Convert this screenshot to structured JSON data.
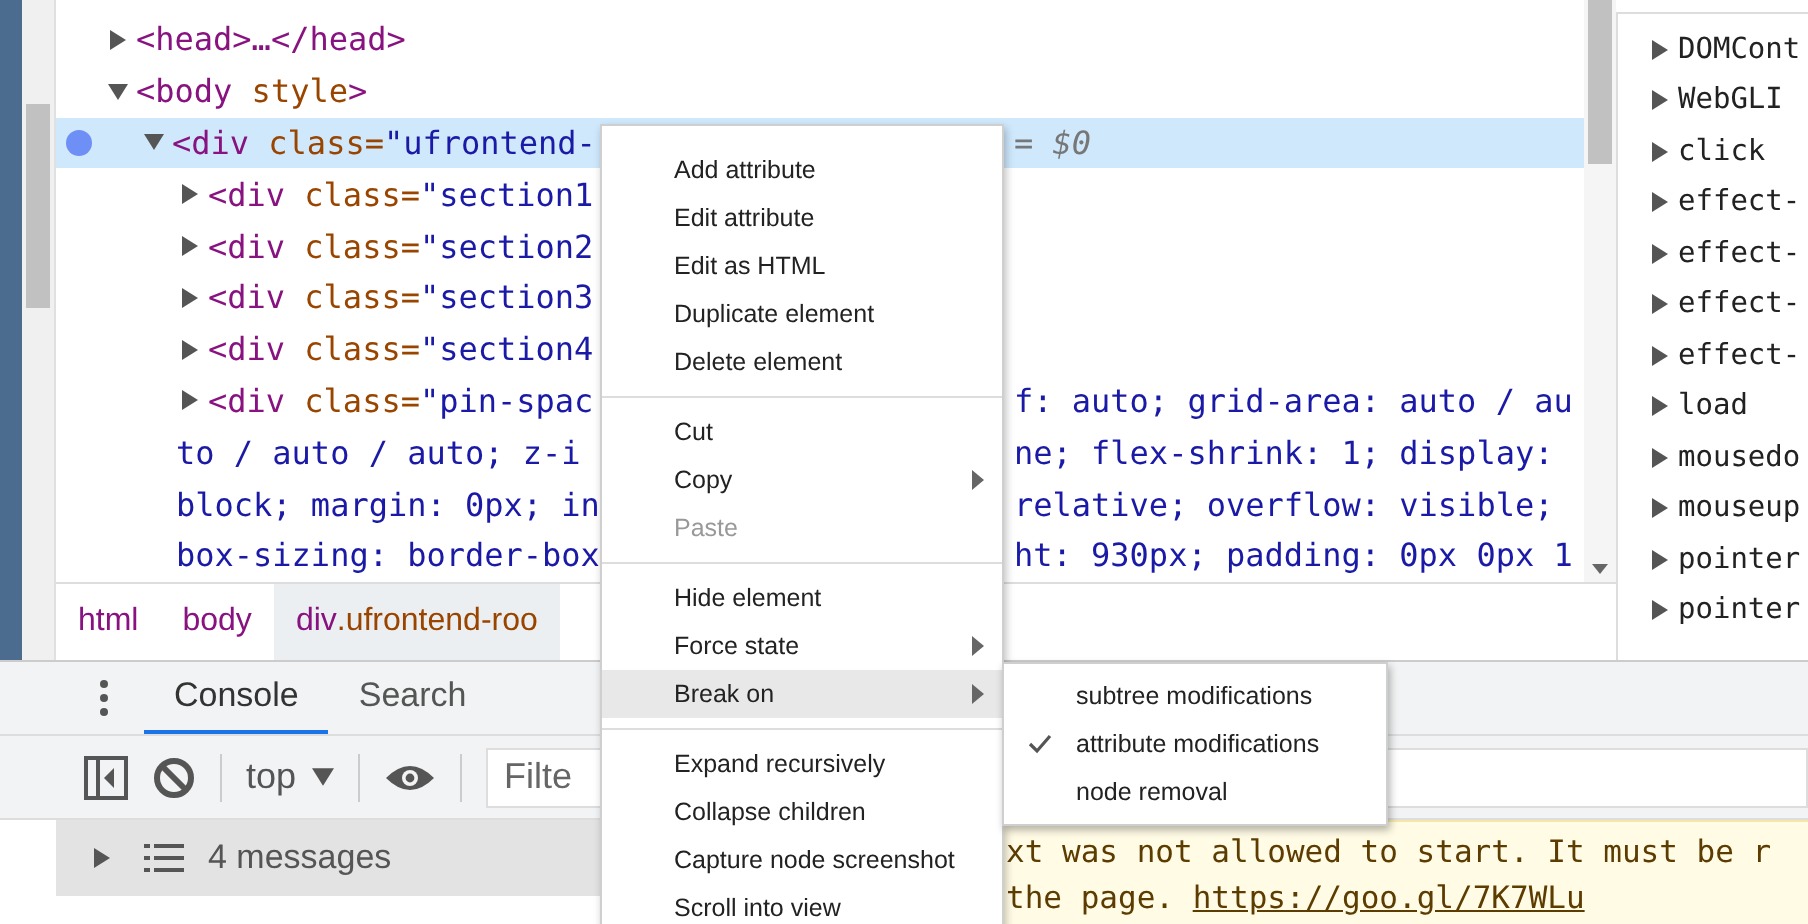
{
  "elements_tree": [
    {
      "text": "<head>…</head>",
      "expanded": false,
      "selected": false,
      "breakpoint": false
    },
    {
      "text": "<body style>",
      "expanded": true,
      "selected": false,
      "breakpoint": false,
      "children": [
        {
          "text": "<div class=\"ufrontend-",
          "marker": "= $0",
          "expanded": true,
          "selected": true,
          "breakpoint": true,
          "children": [
            {
              "text": "<div class=\"section1",
              "expanded": false,
              "selected": false,
              "breakpoint": false
            },
            {
              "text": "<div class=\"section2",
              "expanded": false,
              "selected": false,
              "breakpoint": false
            },
            {
              "text": "<div class=\"section3",
              "expanded": false,
              "selected": false,
              "breakpoint": false
            },
            {
              "text": "<div class=\"section4",
              "expanded": false,
              "selected": false,
              "breakpoint": false
            },
            {
              "text": "<div class=\"pin-spac",
              "after_menu": "f: auto; grid-area: auto / au",
              "expanded": false,
              "selected": false,
              "breakpoint": false,
              "wrapped_lines": [
                {
                  "text": "to / auto / auto; z-i",
                  "after_menu": "ne; flex-shrink: 1; display:"
                },
                {
                  "text": "block; margin: 0px; in",
                  "after_menu": "relative; overflow: visible;"
                },
                {
                  "text": "box-sizing: border-box",
                  "after_menu": "ht: 930px; padding: 0px 0px 1"
                }
              ]
            }
          ]
        }
      ]
    }
  ],
  "breadcrumbs": [
    {
      "text": "html",
      "selected": false
    },
    {
      "text": "body",
      "selected": false
    },
    {
      "text": "div.ufrontend-roo",
      "selected": true
    }
  ],
  "event_listeners": [
    {
      "text": "DOMCont",
      "expanded": false
    },
    {
      "text": "WebGLI",
      "expanded": false
    },
    {
      "text": "click",
      "expanded": false
    },
    {
      "text": "effect-",
      "expanded": false
    },
    {
      "text": "effect-",
      "expanded": false
    },
    {
      "text": "effect-",
      "expanded": false
    },
    {
      "text": "effect-",
      "expanded": false
    },
    {
      "text": "load",
      "expanded": false
    },
    {
      "text": "mousedo",
      "expanded": false
    },
    {
      "text": "mouseup",
      "expanded": false
    },
    {
      "text": "pointer",
      "expanded": false
    },
    {
      "text": "pointer",
      "expanded": false
    }
  ],
  "drawer_tabs": [
    {
      "label": "Console",
      "selected": true
    },
    {
      "label": "Search",
      "selected": false
    }
  ],
  "console_toolbar": {
    "context": "top",
    "filter": {
      "placeholder": "Filte"
    }
  },
  "console_sidebar": {
    "messages": "4 messages",
    "expanded": false
  },
  "warning": {
    "line_1": "xt was not allowed to start. It must be r",
    "line_2": "the page.",
    "link": "https://goo.gl/7K7WLu"
  },
  "context_menu": [
    {
      "kind": "item",
      "label": "Add attribute",
      "submenu": false,
      "disabled": false,
      "selected": false
    },
    {
      "kind": "item",
      "label": "Edit attribute",
      "submenu": false,
      "disabled": false,
      "selected": false
    },
    {
      "kind": "item",
      "label": "Edit as HTML",
      "submenu": false,
      "disabled": false,
      "selected": false
    },
    {
      "kind": "item",
      "label": "Duplicate element",
      "submenu": false,
      "disabled": false,
      "selected": false
    },
    {
      "kind": "item",
      "label": "Delete element",
      "submenu": false,
      "disabled": false,
      "selected": false
    },
    {
      "kind": "separator"
    },
    {
      "kind": "item",
      "label": "Cut",
      "submenu": false,
      "disabled": false,
      "selected": false
    },
    {
      "kind": "item",
      "label": "Copy",
      "submenu": true,
      "disabled": false,
      "selected": false
    },
    {
      "kind": "item",
      "label": "Paste",
      "submenu": false,
      "disabled": true,
      "selected": false
    },
    {
      "kind": "separator"
    },
    {
      "kind": "item",
      "label": "Hide element",
      "submenu": false,
      "disabled": false,
      "selected": false
    },
    {
      "kind": "item",
      "label": "Force state",
      "submenu": true,
      "disabled": false,
      "selected": false
    },
    {
      "kind": "item",
      "label": "Break on",
      "submenu": true,
      "disabled": false,
      "selected": true
    },
    {
      "kind": "separator"
    },
    {
      "kind": "item",
      "label": "Expand recursively",
      "submenu": false,
      "disabled": false,
      "selected": false
    },
    {
      "kind": "item",
      "label": "Collapse children",
      "submenu": false,
      "disabled": false,
      "selected": false
    },
    {
      "kind": "item",
      "label": "Capture node screenshot",
      "submenu": false,
      "disabled": false,
      "selected": false
    },
    {
      "kind": "item",
      "label": "Scroll into view",
      "submenu": false,
      "disabled": false,
      "selected": false
    }
  ],
  "break_on_submenu": [
    {
      "label": "subtree modifications",
      "checked": false
    },
    {
      "label": "attribute modifications",
      "checked": true
    },
    {
      "label": "node removal",
      "checked": false
    }
  ]
}
